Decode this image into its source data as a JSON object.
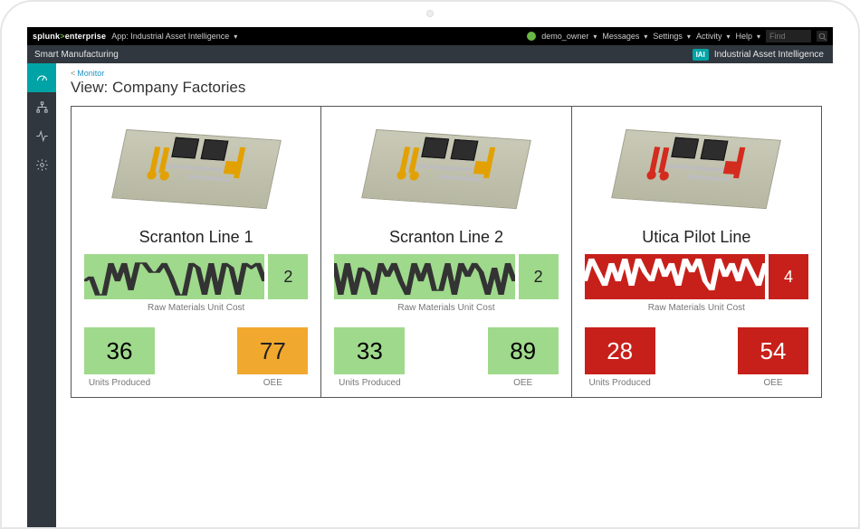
{
  "topbar": {
    "brand_left": "splunk",
    "brand_right": "enterprise",
    "app_label": "App: Industrial Asset Intelligence",
    "user": "demo_owner",
    "menu_messages": "Messages",
    "menu_settings": "Settings",
    "menu_activity": "Activity",
    "menu_help": "Help",
    "find_placeholder": "Find"
  },
  "subbar": {
    "left_label": "Smart Manufacturing",
    "product_badge": "IAI",
    "product_name": "Industrial Asset Intelligence"
  },
  "sidebar": {
    "items": [
      {
        "name": "gauge-icon"
      },
      {
        "name": "tree-icon"
      },
      {
        "name": "activity-icon"
      },
      {
        "name": "gear-icon"
      }
    ]
  },
  "header": {
    "breadcrumb_prefix": "<",
    "breadcrumb_label": "Monitor",
    "view_prefix": "View:",
    "view_name": "Company Factories"
  },
  "status_colors": {
    "good": "#9fd98c",
    "warn": "#f0a92e",
    "bad": "#c7201a"
  },
  "factories": [
    {
      "title": "Scranton Line 1",
      "accent": "accentY",
      "spark_status": "good",
      "spark_stroke": "#333",
      "spark_value": "2",
      "spark_label": "Raw Materials Unit Cost",
      "units_produced": {
        "value": "36",
        "status": "good",
        "label": "Units Produced"
      },
      "oee": {
        "value": "77",
        "status": "warn",
        "label": "OEE"
      }
    },
    {
      "title": "Scranton Line 2",
      "accent": "accentY",
      "spark_status": "good",
      "spark_stroke": "#333",
      "spark_value": "2",
      "spark_label": "Raw Materials Unit Cost",
      "units_produced": {
        "value": "33",
        "status": "good",
        "label": "Units Produced"
      },
      "oee": {
        "value": "89",
        "status": "good",
        "label": "OEE"
      }
    },
    {
      "title": "Utica Pilot Line",
      "accent": "accentR",
      "spark_status": "bad",
      "spark_stroke": "#fff",
      "spark_value": "4",
      "spark_label": "Raw Materials Unit Cost",
      "units_produced": {
        "value": "28",
        "status": "bad",
        "label": "Units Produced"
      },
      "oee": {
        "value": "54",
        "status": "bad",
        "label": "OEE"
      }
    }
  ],
  "chart_data": [
    {
      "type": "line",
      "title": "Scranton Line 1 — Raw Materials Unit Cost",
      "ylabel": "Unit Cost",
      "ylim": [
        0,
        5
      ],
      "current": 2,
      "values": [
        2.0,
        2.5,
        0.5,
        0.5,
        4.0,
        2.0,
        4.0,
        1.0,
        4.0,
        4.0,
        3.0,
        3.0,
        4.0,
        2.5,
        0.5,
        0.5,
        4.0,
        3.5,
        0.5,
        4.0,
        0.5,
        4.0,
        3.5,
        0.5,
        4.0,
        3.5,
        4.0,
        2.0
      ]
    },
    {
      "type": "line",
      "title": "Scranton Line 2 — Raw Materials Unit Cost",
      "ylabel": "Unit Cost",
      "ylim": [
        0,
        5
      ],
      "current": 2,
      "values": [
        4.0,
        0.5,
        4.0,
        0.5,
        3.5,
        3.0,
        0.5,
        4.0,
        2.5,
        4.0,
        2.0,
        0.5,
        4.0,
        2.0,
        4.0,
        1.0,
        1.0,
        4.0,
        0.5,
        4.0,
        2.5,
        4.0,
        3.0,
        0.5,
        3.5,
        0.5,
        4.0,
        2.0
      ]
    },
    {
      "type": "line",
      "title": "Utica Pilot Line — Raw Materials Unit Cost",
      "ylabel": "Unit Cost",
      "ylim": [
        0,
        5
      ],
      "current": 4,
      "values": [
        2.0,
        4.5,
        3.0,
        1.5,
        4.0,
        2.0,
        4.5,
        1.5,
        4.5,
        3.0,
        2.0,
        4.5,
        2.5,
        4.0,
        1.5,
        4.5,
        3.0,
        4.5,
        2.0,
        1.0,
        4.5,
        2.5,
        4.0,
        2.0,
        4.5,
        3.0,
        1.5,
        4.0
      ]
    }
  ]
}
